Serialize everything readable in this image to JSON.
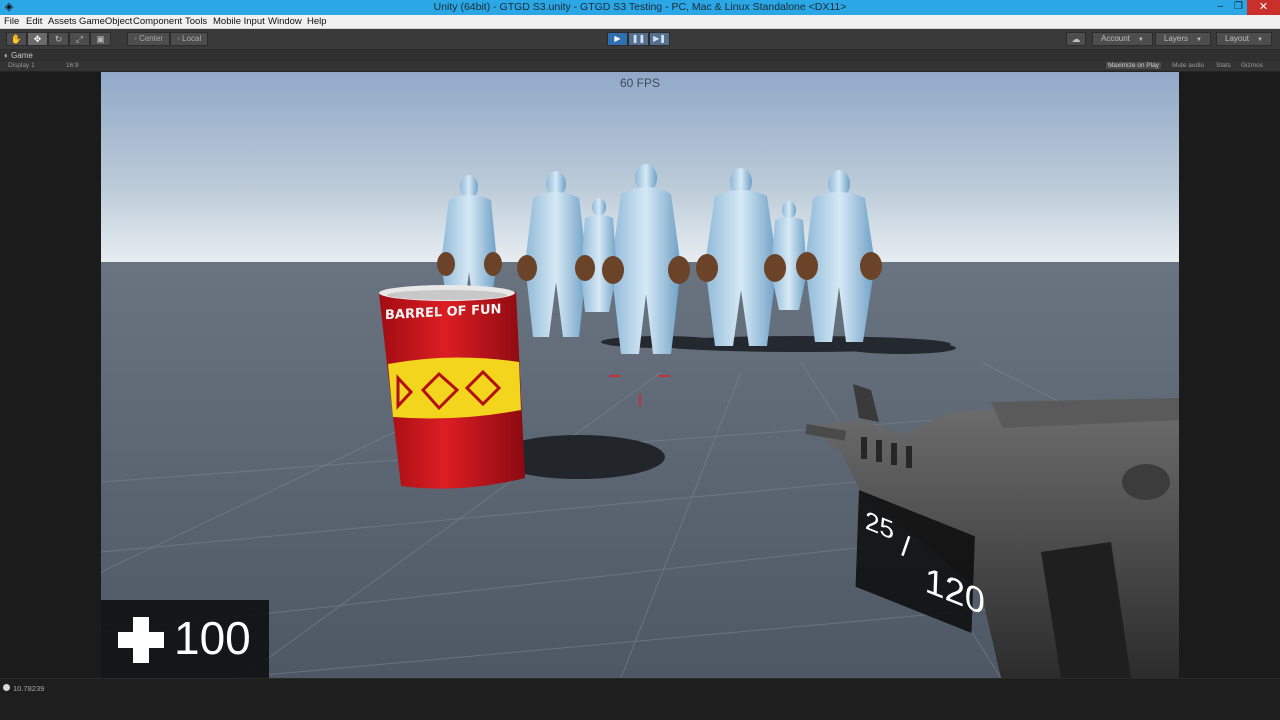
{
  "window": {
    "title": "Unity (64bit) - GTGD S3.unity - GTGD S3 Testing - PC, Mac & Linux Standalone <DX11>",
    "minimize_symbol": "–",
    "maximize_symbol": "❐",
    "close_symbol": "✕"
  },
  "menu": [
    "File",
    "Edit",
    "Assets",
    "GameObject",
    "Component",
    "Tools",
    "Mobile Input",
    "Window",
    "Help"
  ],
  "toolbar": {
    "center_label": "Center",
    "local_label": "Local",
    "account_label": "Account",
    "layers_label": "Layers",
    "layout_label": "Layout"
  },
  "game_view": {
    "tab_label": "Game",
    "display_label": "Display 1",
    "aspect_label": "16:9",
    "maximize_label": "Maximize on Play",
    "mute_label": "Mute audio",
    "stats_label": "Stats",
    "gizmos_label": "Gizmos"
  },
  "hud": {
    "fps": "60 FPS",
    "health": "100",
    "ammo_clip": "25",
    "ammo_separator": "/",
    "ammo_reserve": "120",
    "barrel_text": "BARREL OF FUN"
  },
  "status": {
    "message": "10.78239"
  },
  "colors": {
    "titlebar": "#2ba7e6",
    "close_button": "#c9302c",
    "play_active": "#2f6fb0",
    "sky_top": "#9db3cf",
    "ground": "#56616d",
    "barrel_red": "#c8141c",
    "barrel_yellow": "#f2d51c",
    "crosshair": "#e0201c"
  },
  "icons": {
    "app": "unity-logo-icon",
    "hand": "hand-tool-icon",
    "move": "move-tool-icon",
    "rotate": "rotate-tool-icon",
    "scale": "scale-tool-icon",
    "rect": "rect-tool-icon",
    "play": "play-icon",
    "pause": "pause-icon",
    "step": "step-icon",
    "cloud": "cloud-icon",
    "health": "health-cross-icon"
  }
}
